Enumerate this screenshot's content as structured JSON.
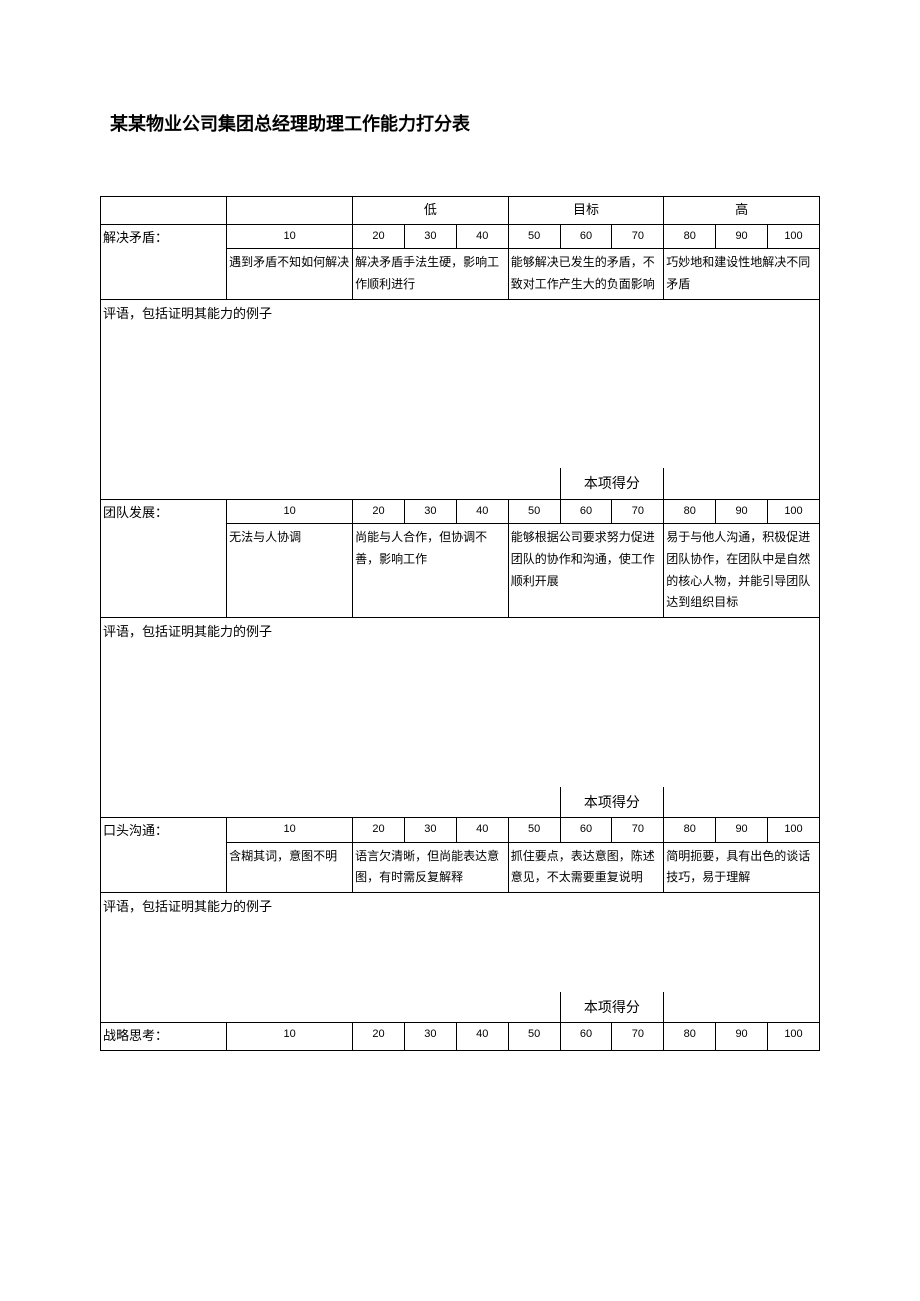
{
  "title": "某某物业公司集团总经理助理工作能力打分表",
  "headers": {
    "low": "低",
    "target": "目标",
    "high": "高"
  },
  "scores": {
    "s10": "10",
    "s20": "20",
    "s30": "30",
    "s40": "40",
    "s50": "50",
    "s60": "60",
    "s70": "70",
    "s80": "80",
    "s90": "90",
    "s100": "100"
  },
  "commentLabel": "评语，包括证明其能力的例子",
  "scoreLabel": "本项得分",
  "sections": {
    "conflict": {
      "label": "解决矛盾：",
      "d1": "遇到矛盾不知如何解决",
      "d2": "解决矛盾手法生硬，影响工作顺利进行",
      "d3": "能够解决已发生的矛盾，不致对工作产生大的负面影响",
      "d4": "巧妙地和建设性地解决不同矛盾"
    },
    "team": {
      "label": "团队发展：",
      "d1": "无法与人协调",
      "d2": "尚能与人合作，但协调不善，影响工作",
      "d3": "能够根据公司要求努力促进团队的协作和沟通，使工作顺利开展",
      "d4": "易于与他人沟通，积极促进团队协作，在团队中是自然的核心人物，并能引导团队达到组织目标"
    },
    "oral": {
      "label": "口头沟通：",
      "d1": "含糊其词，意图不明",
      "d2": "语言欠清晰，但尚能表达意图，有时需反复解释",
      "d3": "抓住要点，表达意图，陈述意见，不太需要重复说明",
      "d4": "简明扼要，具有出色的谈话技巧，易于理解"
    },
    "strategy": {
      "label": "战略思考："
    }
  }
}
